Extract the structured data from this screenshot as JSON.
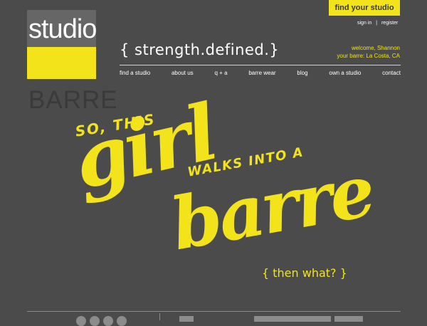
{
  "logo": {
    "line1": "studio",
    "line2": "BARRE"
  },
  "tagline": "{ strength.defined.}",
  "header": {
    "find_studio": "find your studio",
    "sign_in": "sign in",
    "separator": "|",
    "register": "register",
    "welcome": "welcome, Shannon",
    "your_barre": "your barre: La Costa, CA"
  },
  "nav": [
    {
      "label": "find a studio"
    },
    {
      "label": "about us"
    },
    {
      "label": "q + a"
    },
    {
      "label": "barre wear"
    },
    {
      "label": "blog"
    },
    {
      "label": "own a studio"
    },
    {
      "label": "contact"
    }
  ],
  "hero": {
    "line1": "SO, THIS",
    "line2": "girl",
    "line3": "WALKS INTO A",
    "line4": "barre",
    "line5": "{ then what? }"
  },
  "footer": {
    "social_icons": [
      "facebook-icon",
      "twitter-icon",
      "pinterest-icon",
      "instagram-icon"
    ]
  },
  "colors": {
    "accent": "#f2e31a",
    "background": "#4b4b4b",
    "logo_gray": "#666666"
  }
}
